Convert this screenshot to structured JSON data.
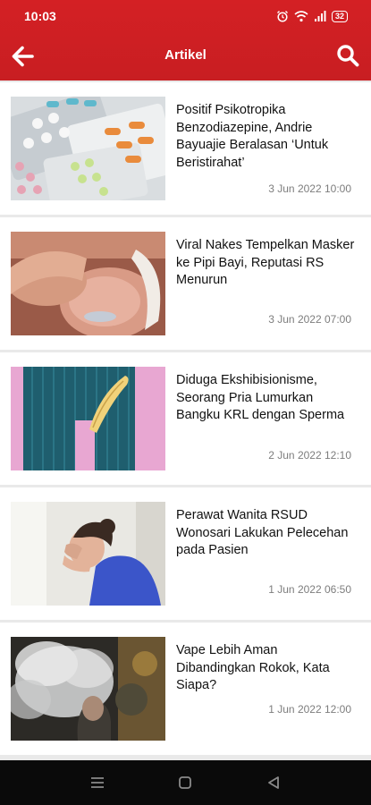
{
  "status_bar": {
    "time": "10:03",
    "battery": "32"
  },
  "app_bar": {
    "title": "Artikel",
    "back_icon": "arrow-left-icon",
    "search_icon": "search-icon"
  },
  "articles": [
    {
      "title": "Positif Psikotropika Benzodiazepine, Andrie Bayuajie Beralasan ‘Untuk Beristirahat’",
      "date": "3 Jun 2022 10:00",
      "image": "pills-blister-image"
    },
    {
      "title": "Viral Nakes Tempelkan Masker ke Pipi Bayi, Reputasi RS Menurun",
      "date": "3 Jun 2022 07:00",
      "image": "newborn-baby-image"
    },
    {
      "title": "Diduga Ekshibisionisme, Seorang Pria Lumurkan Bangku KRL dengan Sperma",
      "date": "2 Jun 2022 12:10",
      "image": "curtain-banana-image"
    },
    {
      "title": "Perawat Wanita RSUD Wonosari Lakukan Pelecehan pada Pasien",
      "date": "1 Jun 2022 06:50",
      "image": "nurse-crying-image"
    },
    {
      "title": "Vape Lebih Aman Dibandingkan Rokok, Kata Siapa?",
      "date": "1 Jun 2022 12:00",
      "image": "vape-smoke-image"
    }
  ],
  "nav_bar": {
    "icons": [
      "recent-apps-icon",
      "home-icon",
      "back-triangle-icon"
    ]
  },
  "colors": {
    "primary": "#d42024",
    "background": "#e9e9e9",
    "card": "#ffffff",
    "date_text": "#7d7d7d"
  }
}
